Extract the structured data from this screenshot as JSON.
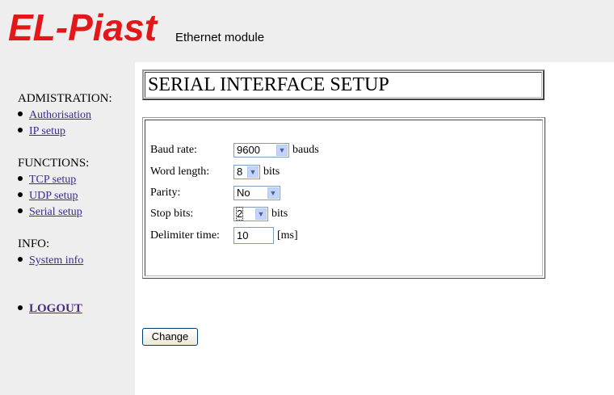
{
  "header": {
    "logo_text": "EL-Piast",
    "subtitle": "Ethernet module"
  },
  "sidebar": {
    "admin_title": "ADMISTRATION:",
    "admin_items": [
      "Authorisation",
      "IP setup"
    ],
    "functions_title": "FUNCTIONS:",
    "functions_items": [
      "TCP setup",
      "UDP setup",
      "Serial setup"
    ],
    "info_title": "INFO:",
    "info_items": [
      "System info"
    ],
    "logout": "LOGOUT"
  },
  "main": {
    "title": "SERIAL INTERFACE SETUP",
    "form": {
      "baud_rate": {
        "label": "Baud rate:",
        "value": "9600",
        "unit": "bauds"
      },
      "word_length": {
        "label": "Word length:",
        "value": "8",
        "unit": "bits"
      },
      "parity": {
        "label": "Parity:",
        "value": "No"
      },
      "stop_bits": {
        "label": "Stop bits:",
        "value": "2",
        "unit": "bits"
      },
      "delimiter_time": {
        "label": "Delimiter time:",
        "value": "10",
        "unit": "[ms]"
      }
    },
    "change_button": "Change"
  },
  "colors": {
    "logo": "#e3161a",
    "sidebar_bg": "#eeeeee",
    "link": "#3a2b8f"
  }
}
